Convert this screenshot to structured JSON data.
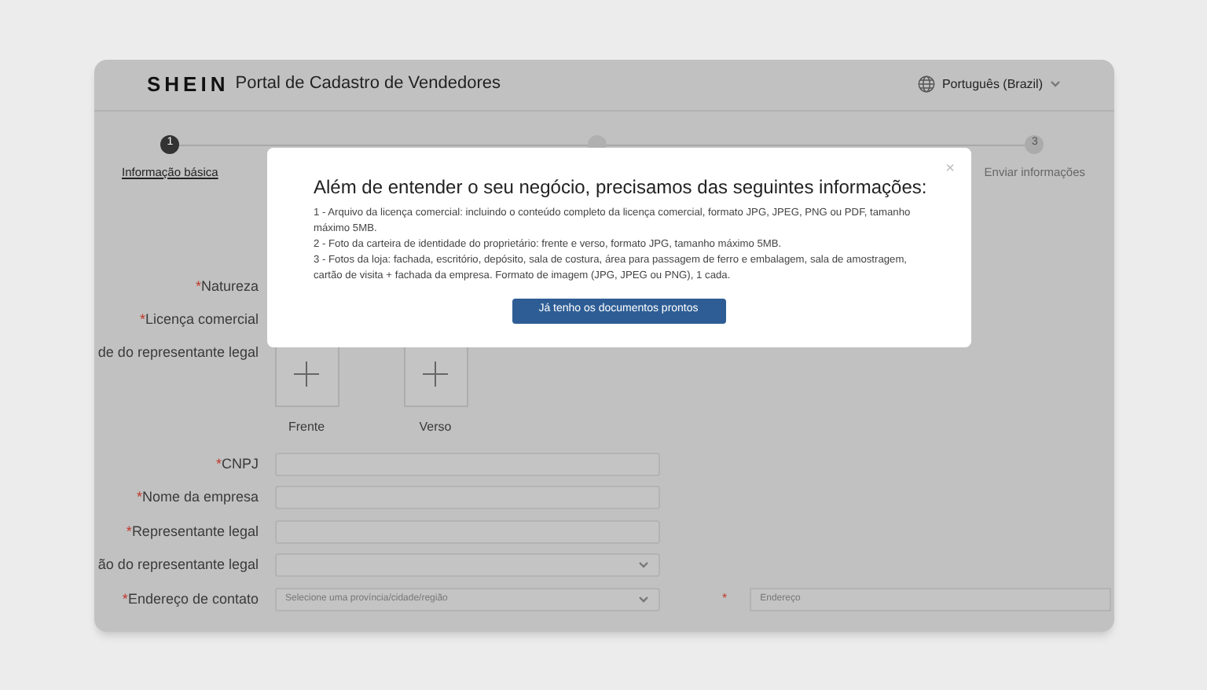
{
  "header": {
    "logo": "SHEIN",
    "title": "Portal de Cadastro de Vendedores",
    "language": "Português (Brazil)"
  },
  "steps": [
    {
      "number": "1",
      "label": "Informação básica",
      "selected": true
    },
    {
      "number": "3",
      "label": "Enviar informações",
      "selected": false
    }
  ],
  "form": {
    "rows": [
      {
        "kind": "text",
        "label": "Natureza",
        "marker": "*"
      },
      {
        "kind": "text",
        "label": "Licença comercial",
        "marker": "*"
      },
      {
        "kind": "upload",
        "label": "de do representante legal",
        "slots": [
          "Frente",
          "Verso"
        ]
      },
      {
        "kind": "input",
        "label": "CNPJ",
        "marker": "*"
      },
      {
        "kind": "input",
        "label": "Nome da empresa",
        "marker": "*"
      },
      {
        "kind": "input",
        "label": "Representante legal",
        "marker": "*"
      },
      {
        "kind": "select",
        "label": "ão do representante legal"
      },
      {
        "kind": "address",
        "label": "Endereço de contato",
        "marker": "*",
        "placeholder": "Selecione uma província/cidade/região",
        "second_marker": "*",
        "second_placeholder": "Endereço"
      }
    ]
  },
  "modal": {
    "title": "Além de entender o seu negócio, precisamos das seguintes informações:",
    "close": "×",
    "lines": [
      "1 - Arquivo da licença comercial: incluindo o conteúdo completo da licença comercial, formato JPG, JPEG, PNG ou PDF, tamanho máximo 5MB.",
      "2 - Foto da carteira de identidade do proprietário: frente e verso, formato JPG, tamanho máximo 5MB.",
      "3 - Fotos da loja: fachada, escritório, depósito, sala de costura, área para passagem de ferro e embalagem, sala de amostragem, cartão de visita + fachada da empresa. Formato de imagem (JPG, JPEG ou PNG), 1 cada."
    ],
    "button": "Já tenho os documentos prontos"
  }
}
